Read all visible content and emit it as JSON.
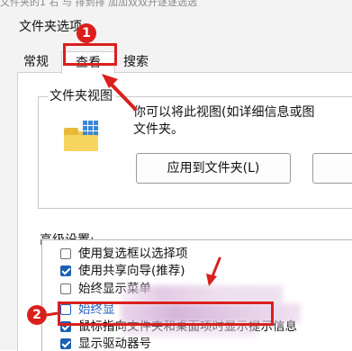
{
  "top_strip_text": "文件夹的1    右 与 排到排 加加双双开逐逐选选",
  "dialog": {
    "title": "文件夹选项",
    "tabs": [
      {
        "label": "常规",
        "selected": false
      },
      {
        "label": "查看",
        "selected": true
      },
      {
        "label": "搜索",
        "selected": false
      }
    ]
  },
  "folder_views": {
    "group_title": "文件夹视图",
    "description": "你可以将此视图(如详细信息或图\n文件夹。",
    "icon": "folder-icon",
    "apply_button_label": "应用到文件夹(L)"
  },
  "advanced": {
    "label": "高级设置:",
    "options": [
      {
        "label": "使用复选框以选择项",
        "checked": false
      },
      {
        "label": "使用共享向导(推荐)",
        "checked": true
      },
      {
        "label": "始终显示菜单",
        "checked": false
      },
      {
        "label": "始终显",
        "checked": false
      },
      {
        "label": "鼠标指向文件夹和桌面项时显示提示信息",
        "checked": true
      },
      {
        "label": "显示驱动器号",
        "checked": true
      }
    ]
  },
  "annotations": {
    "step_1": "1",
    "step_2": "2",
    "accent_color": "#d9201c"
  }
}
